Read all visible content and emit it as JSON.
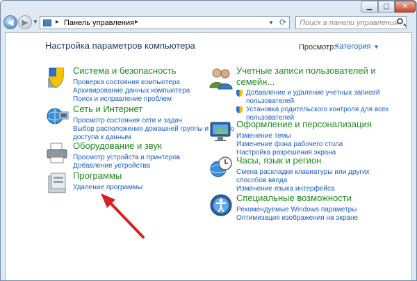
{
  "window": {
    "address": "Панель управления",
    "search_placeholder": "Поиск в панели управления"
  },
  "main": {
    "heading": "Настройка параметров компьютера",
    "view_label": "Просмотр:",
    "view_value": "Категория"
  },
  "categories_left": [
    {
      "title": "Система и безопасность",
      "links": [
        "Проверка состояния компьютера",
        "Архивирование данных компьютера",
        "Поиск и исправление проблем"
      ]
    },
    {
      "title": "Сеть и Интернет",
      "links": [
        "Просмотр состояния сети и задач",
        "Выбор расположения домашней группы и общего",
        "доступа к данным"
      ]
    },
    {
      "title": "Оборудование и звук",
      "links": [
        "Просмотр устройств и принтеров",
        "Добавление устройства"
      ]
    },
    {
      "title": "Программы",
      "links": [
        "Удаление программы"
      ]
    }
  ],
  "categories_right": [
    {
      "title_line1": "Учетные записи пользователей и",
      "title_line2": "семейн...",
      "links": [
        "Добавление и удаление учетных записей",
        "пользователей",
        "Установка родительского контроля для всех",
        "пользователей"
      ]
    },
    {
      "title": "Оформление и персонализация",
      "links": [
        "Изменение темы",
        "Изменение фона рабочего стола",
        "Настройка разрешения экрана"
      ]
    },
    {
      "title": "Часы, язык и регион",
      "links": [
        "Смена раскладки клавиатуры или других",
        "способов ввода",
        "Изменение языка интерфейса"
      ]
    },
    {
      "title": "Специальные возможности",
      "links": [
        "Рекомендуемые Windows параметры",
        "Оптимизация изображения на экране"
      ]
    }
  ]
}
